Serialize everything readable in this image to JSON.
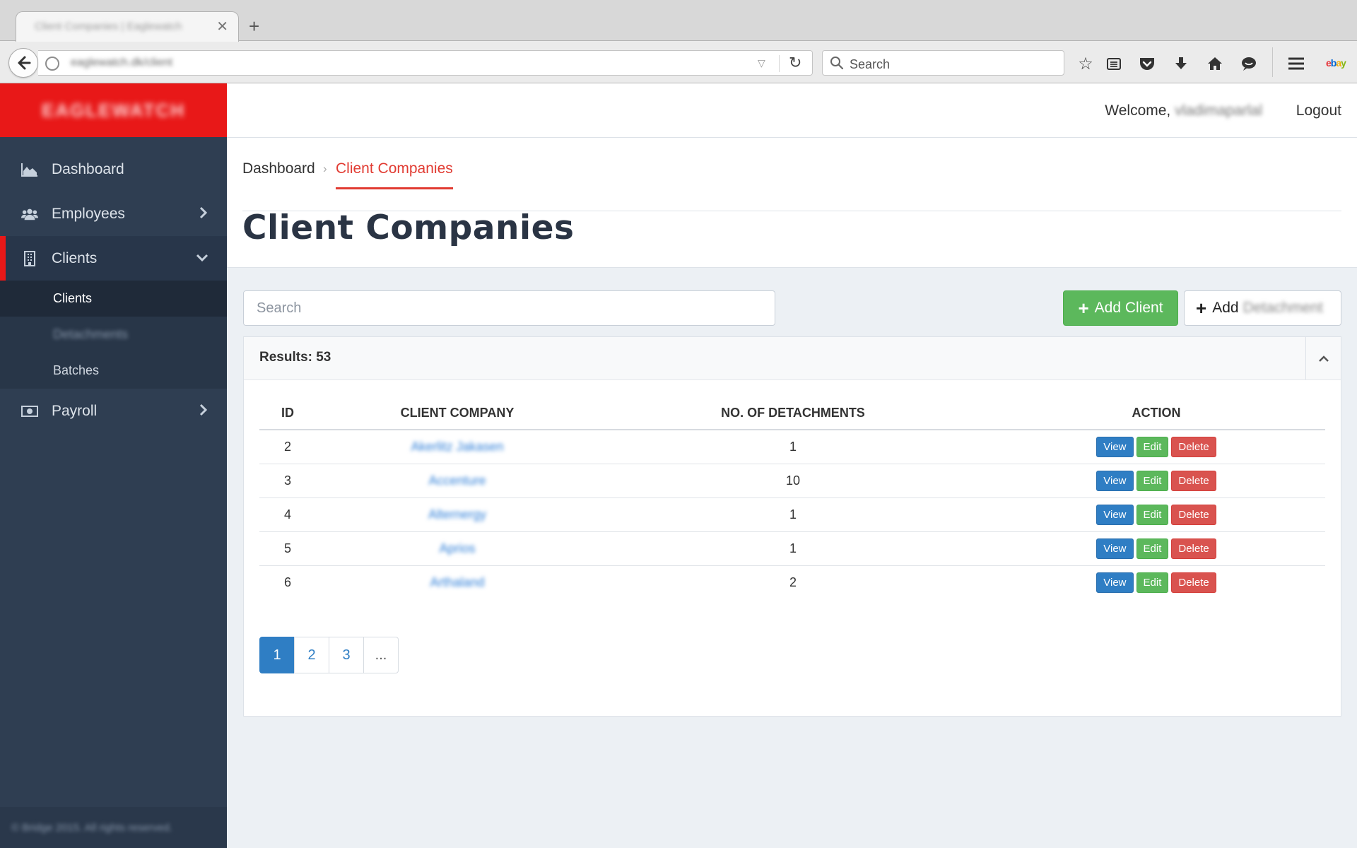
{
  "browser": {
    "tab_title": "Client Companies | Eaglewatch",
    "url": "eaglewatch.dk/client",
    "search_placeholder": "Search",
    "toolbar_icons": [
      "star-icon",
      "reading-list-icon",
      "pocket-icon",
      "download-icon",
      "home-icon",
      "chat-icon",
      "menu-icon"
    ],
    "ebay_label": "ebay"
  },
  "app": {
    "logo": "EAGLEWATCH",
    "accent_color": "#e81818",
    "sidebar": {
      "items": [
        {
          "label": "Dashboard",
          "icon": "chart-area-icon"
        },
        {
          "label": "Employees",
          "icon": "users-icon"
        },
        {
          "label": "Clients",
          "icon": "building-icon"
        },
        {
          "label": "Payroll",
          "icon": "money-icon"
        }
      ],
      "sub_items": [
        {
          "label": "Clients"
        },
        {
          "label": "Detachments"
        },
        {
          "label": "Batches"
        }
      ],
      "footer": "© Bridge 2015. All rights reserved."
    },
    "header": {
      "welcome": "Welcome,",
      "username": "vladimaparlal",
      "logout": "Logout"
    }
  },
  "page": {
    "breadcrumb": {
      "home": "Dashboard",
      "sep": "›",
      "current": "Client Companies"
    },
    "title": "Client Companies",
    "search_placeholder": "Search",
    "add_client": "Add Client",
    "add_detachment_prefix": "Add",
    "add_detachment_rest": "Detachment",
    "results_label": "Results: 53",
    "table": {
      "headers": [
        "ID",
        "CLIENT COMPANY",
        "NO. OF DETACHMENTS",
        "ACTION"
      ],
      "rows": [
        {
          "id": "2",
          "company": "Akerlitz Jakasen",
          "detachments": "1"
        },
        {
          "id": "3",
          "company": "Accenture",
          "detachments": "10"
        },
        {
          "id": "4",
          "company": "Alternergy",
          "detachments": "1"
        },
        {
          "id": "5",
          "company": "Aprios",
          "detachments": "1"
        },
        {
          "id": "6",
          "company": "Arthaland",
          "detachments": "2"
        }
      ],
      "actions": {
        "view": "View",
        "edit": "Edit",
        "delete": "Delete"
      }
    },
    "pagination": [
      "1",
      "2",
      "3",
      "..."
    ],
    "current_page": "1"
  }
}
